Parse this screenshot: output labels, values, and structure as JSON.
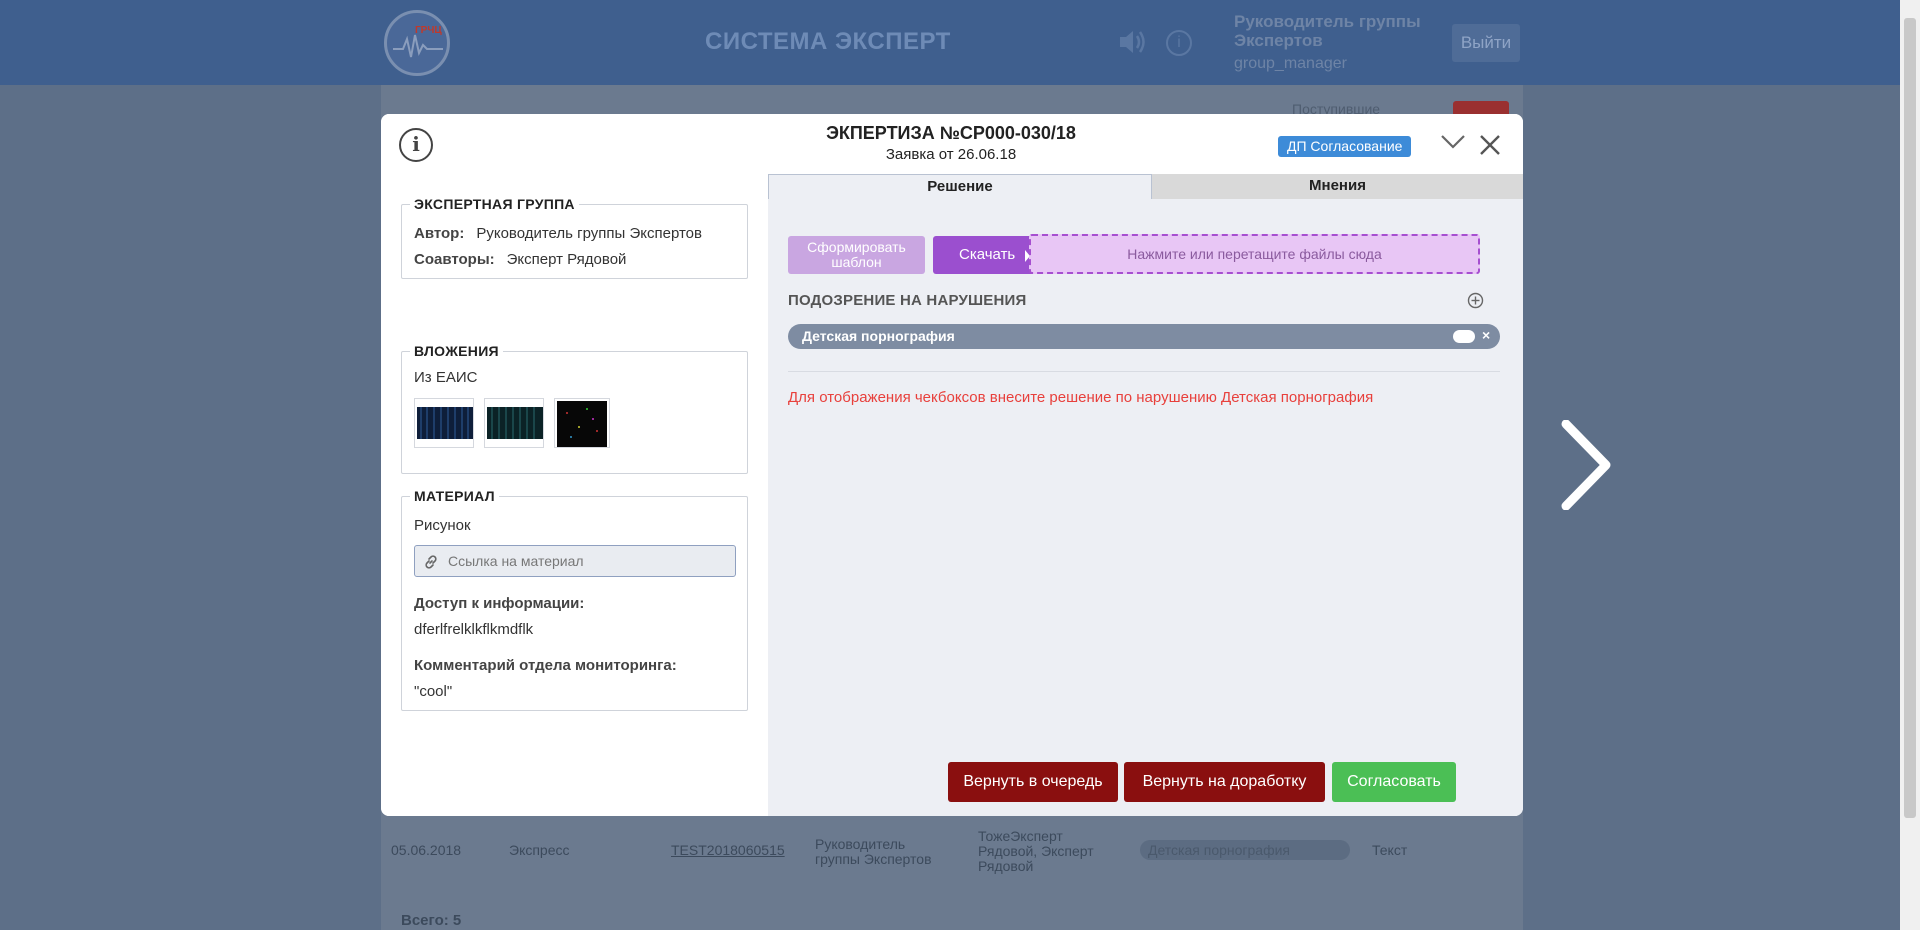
{
  "app": {
    "title": "СИСТЕМА ЭКСПЕРТ",
    "logo_text": "ГРЧЦ",
    "user_role": "Руководитель группы Экспертов",
    "user_login": "group_manager",
    "logout_label": "Выйти",
    "incoming_label": "Поступившие"
  },
  "background_row": {
    "date": "05.06.2018",
    "type": "Экспресс",
    "link": "TEST2018060515",
    "author": "Руководитель группы Экспертов",
    "coauthors": "ТожеЭксперт Рядовой, Эксперт Рядовой",
    "violation": "Детская порнография",
    "material": "Текст",
    "total": "Всего: 5"
  },
  "modal": {
    "title": "ЭКПЕРТИЗА №CP000-030/18",
    "subtitle": "Заявка от 26.06.18",
    "status_badge": "ДП Согласование",
    "expert_group": {
      "legend": "ЭКСПЕРТНАЯ ГРУППА",
      "author_key": "Автор:",
      "author_value": "Руководитель группы Экспертов",
      "coauthors_key": "Соавторы:",
      "coauthors_value": "Эксперт Рядовой"
    },
    "attachments": {
      "legend": "ВЛОЖЕНИЯ",
      "source": "Из ЕАИС"
    },
    "material": {
      "legend": "МАТЕРИАЛ",
      "type": "Рисунок",
      "link_placeholder": "Ссылка на материал",
      "access_key": "Доступ к информации:",
      "access_value": "dferlfrelklkflkmdflk",
      "comment_key": "Комментарий отдела мониторинга:",
      "comment_value": "\"cool\""
    },
    "tabs": [
      {
        "label": "Решение",
        "active": true
      },
      {
        "label": "Мнения",
        "active": false
      }
    ],
    "decision": {
      "template_button": "Сформировать шаблон",
      "download_button": "Скачать",
      "dropzone_text": "Нажмите или перетащите файлы сюда",
      "suspicion_title": "ПОДОЗРЕНИЕ НА НАРУШЕНИЯ",
      "violation": "Детская порнография",
      "warning": "Для отображения чекбоксов внесите решение по нарушению Детская порнография"
    },
    "actions": {
      "requeue": "Вернуть в очередь",
      "rework": "Вернуть на доработку",
      "approve": "Согласовать"
    }
  },
  "colors": {
    "danger": "#8a0f0f",
    "success": "#4bbf55",
    "accent_purple": "#9b4fcf",
    "badge_blue": "#3d8bd8",
    "warning_red": "#e8403c"
  }
}
